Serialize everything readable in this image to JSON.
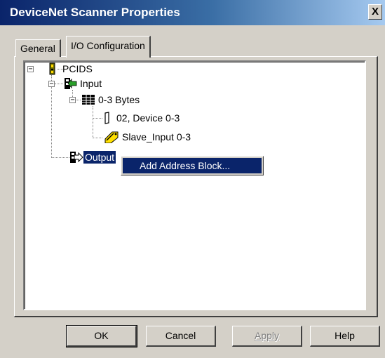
{
  "window": {
    "title": "DeviceNet Scanner Properties",
    "close_glyph": "X"
  },
  "tabs": [
    {
      "label": "General",
      "active": false
    },
    {
      "label": "I/O Configuration",
      "active": true
    }
  ],
  "tree": {
    "expanders": {
      "collapse": "−"
    },
    "nodes": [
      {
        "label": "PCIDS",
        "icon": "scanner-device-icon",
        "expanded": true
      },
      {
        "label": "Input",
        "icon": "input-arrow-icon",
        "expanded": true
      },
      {
        "label": "0-3 Bytes",
        "icon": "table-grid-icon",
        "expanded": true
      },
      {
        "label": "02, Device 0-3",
        "icon": "device-bracket-icon"
      },
      {
        "label": "Slave_Input 0-3",
        "icon": "tag-pencil-icon"
      },
      {
        "label": "Output",
        "icon": "output-arrow-icon",
        "selected": true
      }
    ]
  },
  "context_menu": {
    "items": [
      {
        "label": "Add Address Block..."
      }
    ]
  },
  "buttons": {
    "ok": "OK",
    "cancel": "Cancel",
    "apply": "Apply",
    "help": "Help"
  },
  "colors": {
    "selection": "#0a246a",
    "face": "#d4d0c8",
    "title_start": "#0a246a"
  }
}
